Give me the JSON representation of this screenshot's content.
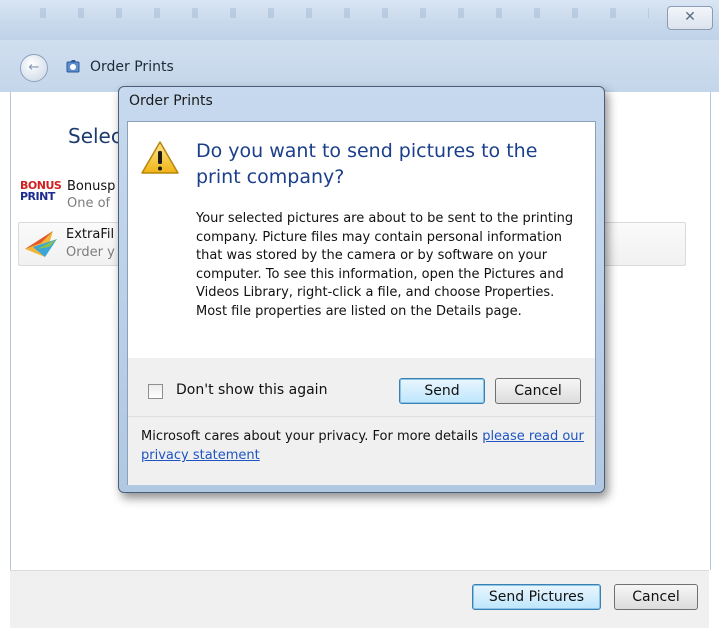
{
  "outer_window": {
    "close_glyph": "✕",
    "back_glyph": "←",
    "title": "Order Prints",
    "heading": "Selec",
    "providers": [
      {
        "name": "Bonusp",
        "description": "One of",
        "logo_top": "BONUS",
        "logo_bottom": "PRINT"
      },
      {
        "name": "ExtraFil",
        "description": "Order y"
      }
    ],
    "send_pictures_label": "Send Pictures",
    "cancel_label": "Cancel"
  },
  "dialog": {
    "title": "Order Prints",
    "question": "Do you want to send pictures to the print company?",
    "body": "Your selected pictures are about to be sent to the printing company. Picture files may contain personal information that was stored by the camera or by software on your computer. To see this information, open the Pictures and Videos Library, right-click a file, and choose Properties. Most file properties are listed on the Details page.",
    "dont_show_label": "Don't show this again",
    "dont_show_checked": false,
    "send_label": "Send",
    "cancel_label": "Cancel",
    "privacy_text": "Microsoft cares about your privacy. For more details ",
    "privacy_link": "please read our privacy statement"
  },
  "colors": {
    "heading_blue": "#1b3f8b",
    "link_blue": "#1f55c0",
    "warning_yellow": "#f3c32a",
    "bonus_red": "#d21f1f"
  },
  "icons": [
    "close-icon",
    "back-arrow-icon",
    "order-prints-icon",
    "warning-icon",
    "bonusprint-logo",
    "extrafilm-logo"
  ]
}
